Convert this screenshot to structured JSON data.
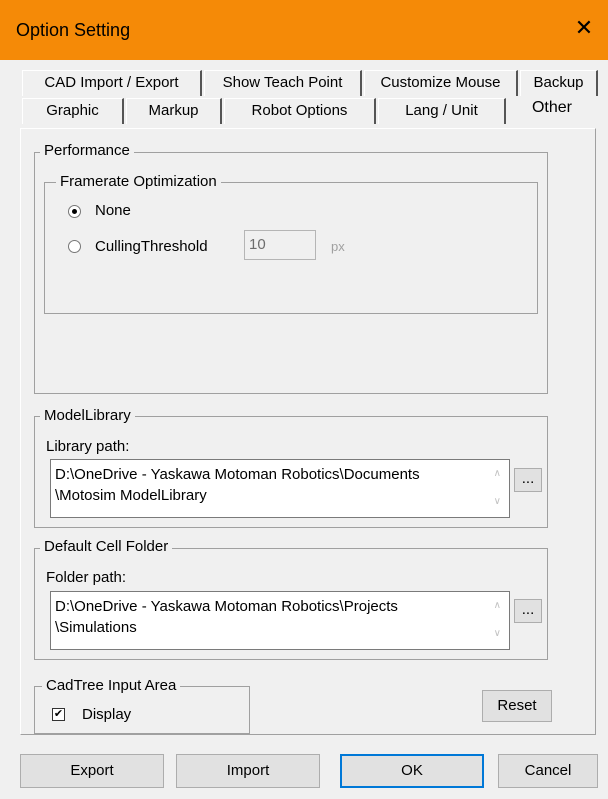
{
  "window": {
    "title": "Option Setting"
  },
  "tabs_row1": [
    "CAD  Import / Export",
    "Show Teach Point",
    "Customize Mouse",
    "Backup"
  ],
  "tabs_row2": [
    "Graphic",
    "Markup",
    "Robot Options",
    "Lang / Unit",
    "Other"
  ],
  "performance": {
    "label": "Performance",
    "framerate": {
      "label": "Framerate Optimization",
      "option_none": "None",
      "option_culling": "CullingThreshold",
      "selected": "None",
      "threshold_value": "10",
      "threshold_unit": "px"
    }
  },
  "model_library": {
    "label": "ModelLibrary",
    "path_label": "Library path:",
    "path_line1": "D:\\OneDrive - Yaskawa Motoman Robotics\\Documents",
    "path_line2": "\\Motosim ModelLibrary",
    "browse": "..."
  },
  "cell_folder": {
    "label": "Default Cell Folder",
    "path_label": "Folder path:",
    "path_line1": "D:\\OneDrive - Yaskawa Motoman Robotics\\Projects",
    "path_line2": "\\Simulations",
    "browse": "..."
  },
  "cadtree": {
    "label": "CadTree Input Area",
    "display": "Display",
    "display_checked": true
  },
  "buttons": {
    "reset": "Reset",
    "export": "Export",
    "import": "Import",
    "ok": "OK",
    "cancel": "Cancel"
  },
  "icons": {
    "close": "close-icon",
    "radio": "radio-icon",
    "checkbox": "checkbox-icon",
    "scroll_up": "chevron-up-icon",
    "scroll_down": "chevron-down-icon"
  },
  "colors": {
    "titlebar": "#f58a07",
    "default_button_border": "#0078d7"
  }
}
